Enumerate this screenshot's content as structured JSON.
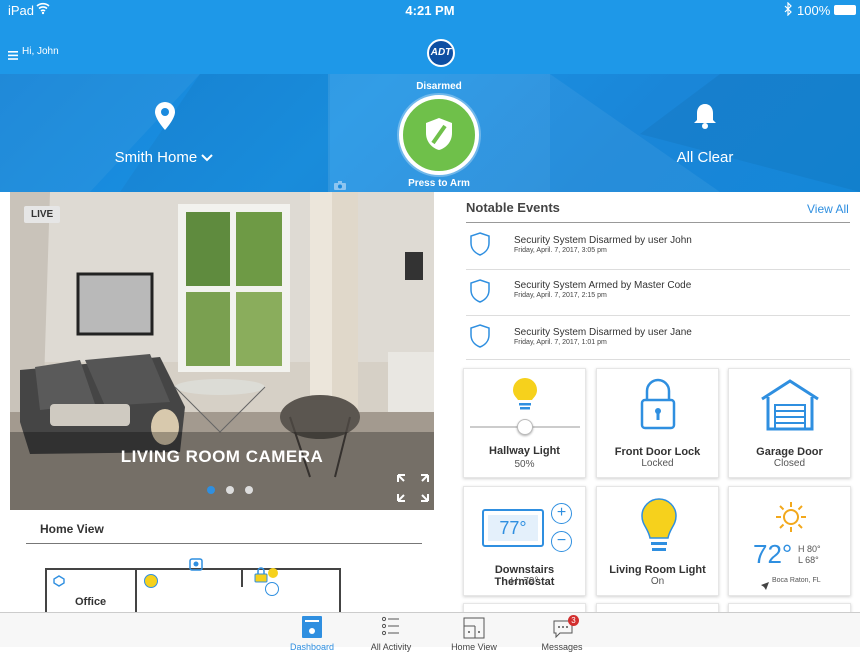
{
  "status_bar": {
    "carrier": "iPad",
    "time": "4:21 PM",
    "battery": "100%"
  },
  "header": {
    "greeting": "Hi, John",
    "logo_text": "ADT"
  },
  "hero": {
    "location": "Smith Home",
    "arm_state": "Disarmed",
    "arm_action": "Press to Arm",
    "alert_status": "All Clear"
  },
  "camera": {
    "live_badge": "LIVE",
    "name": "LIVING ROOM CAMERA"
  },
  "home_view": {
    "title": "Home View",
    "room_label": "Office"
  },
  "events": {
    "title": "Notable Events",
    "view_all": "View All",
    "items": [
      {
        "title": "Security System Disarmed by user John",
        "time": "Friday, April. 7, 2017, 3:05 pm"
      },
      {
        "title": "Security System Armed by Master Code",
        "time": "Friday, April. 7, 2017, 2:15 pm"
      },
      {
        "title": "Security System Disarmed by user Jane",
        "time": "Friday, April. 7, 2017, 1:01 pm"
      }
    ]
  },
  "devices": {
    "hallway_light": {
      "name": "Hallway Light",
      "state": "50%",
      "level": 0.5
    },
    "front_door_lock": {
      "name": "Front Door Lock",
      "state": "Locked"
    },
    "garage_door": {
      "name": "Garage Door",
      "state": "Closed"
    },
    "thermostat": {
      "name": "Downstairs Thermostat",
      "state": "H: 79°",
      "setpoint": "77°"
    },
    "living_room_light": {
      "name": "Living Room Light",
      "state": "On"
    },
    "weather": {
      "temp": "72°",
      "high": "H 80°",
      "low": "L 68°",
      "location": "Boca Raton, FL"
    }
  },
  "nav": {
    "items": [
      {
        "label": "Dashboard"
      },
      {
        "label": "All Activity"
      },
      {
        "label": "Home View"
      },
      {
        "label": "Messages",
        "badge": "3"
      }
    ]
  },
  "colors": {
    "brand_blue": "#1e98e8",
    "accent_blue": "#2f8fe0",
    "green": "#6fc04a",
    "yellow": "#f6d11c"
  }
}
